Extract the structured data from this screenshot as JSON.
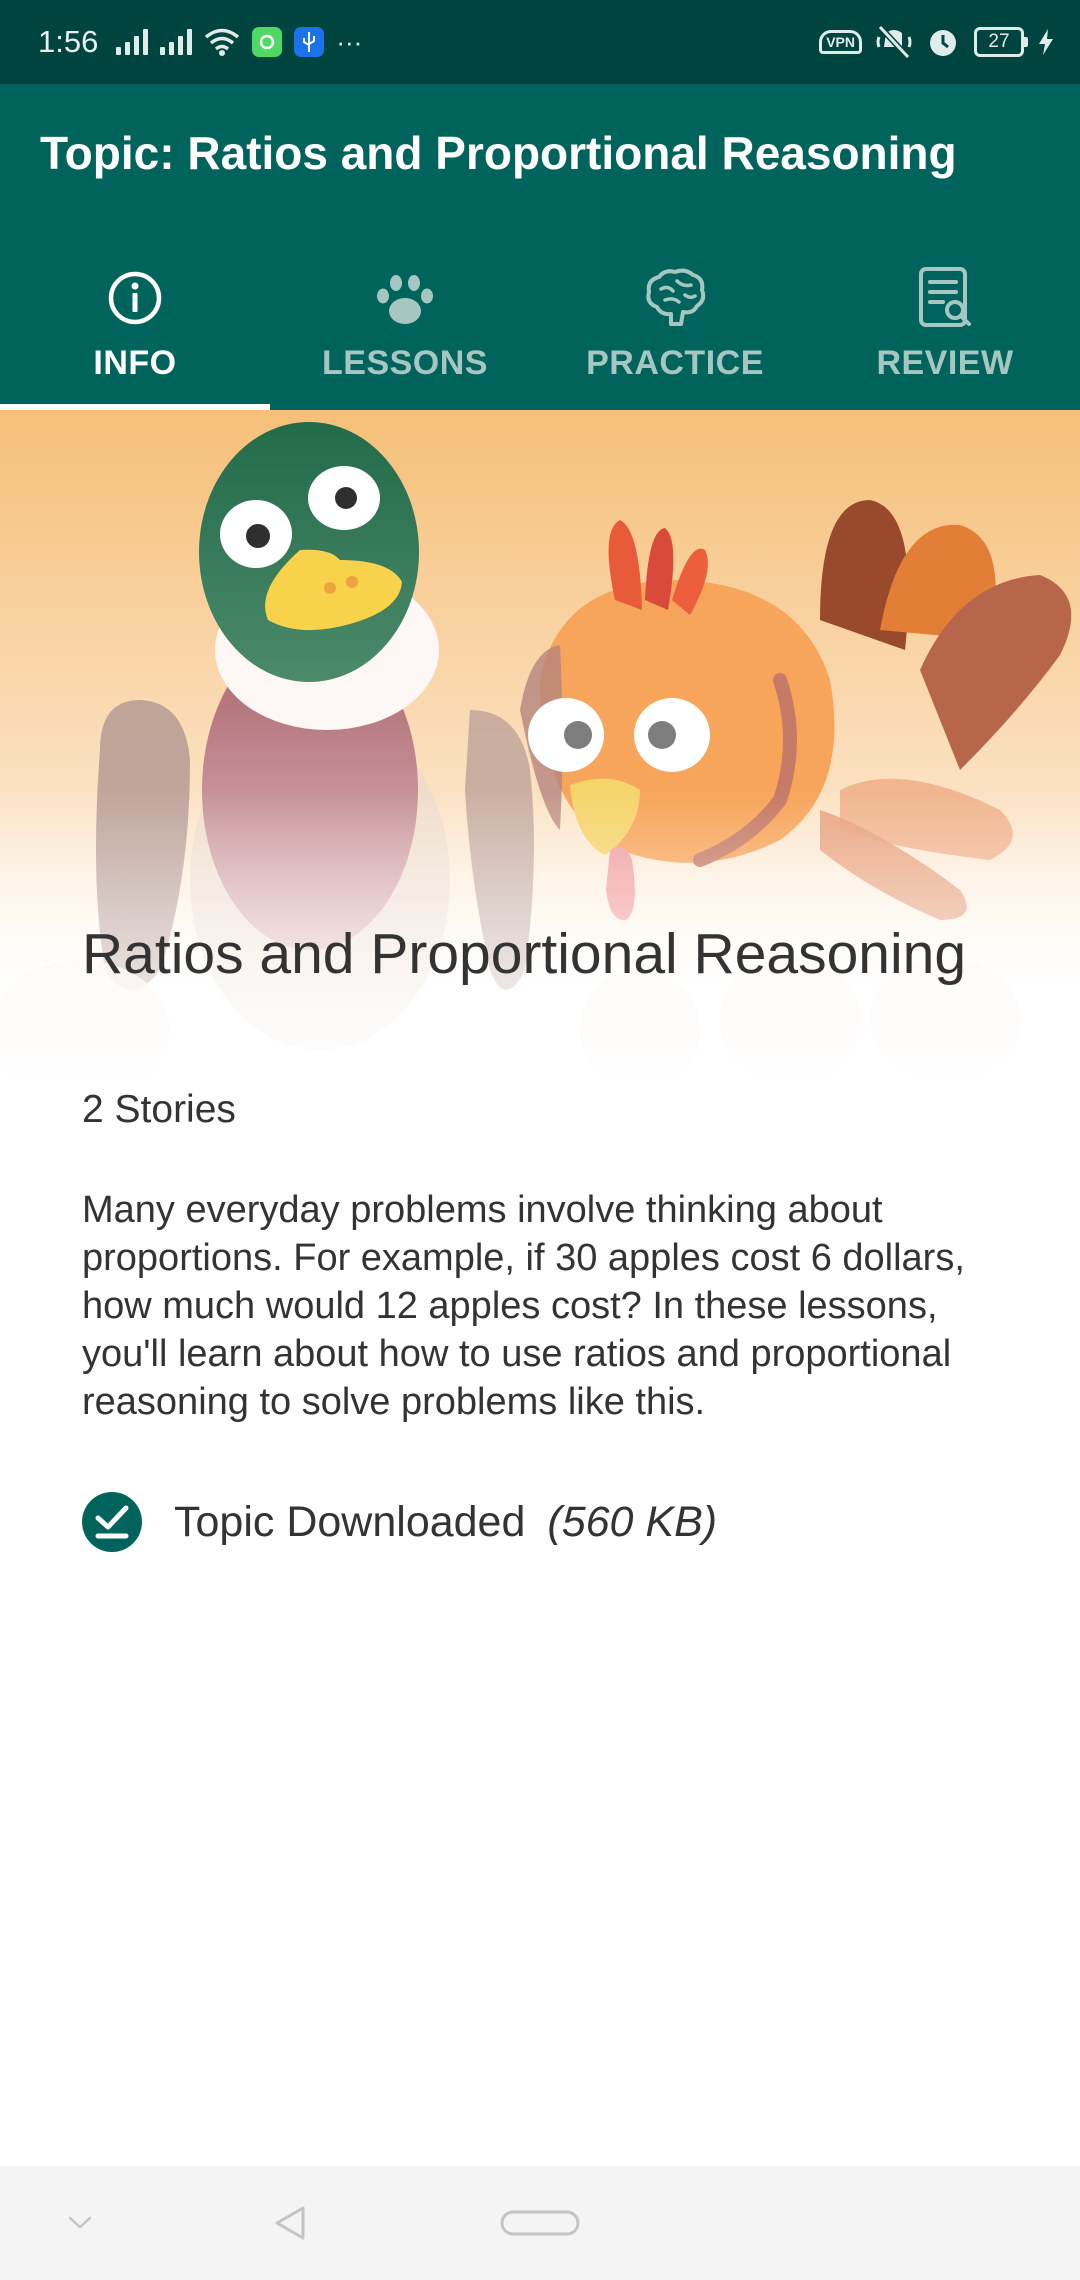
{
  "status_bar": {
    "time": "1:56",
    "more": "···",
    "vpn_label": "VPN",
    "battery_level": "27"
  },
  "app_bar": {
    "title": "Topic: Ratios and Proportional Reasoning"
  },
  "tabs": [
    {
      "label": "INFO",
      "icon": "info-icon",
      "active": true
    },
    {
      "label": "LESSONS",
      "icon": "paw-icon",
      "active": false
    },
    {
      "label": "PRACTICE",
      "icon": "brain-icon",
      "active": false
    },
    {
      "label": "REVIEW",
      "icon": "review-icon",
      "active": false
    }
  ],
  "topic": {
    "name": "Ratios and Proportional Reasoning",
    "story_count": "2 Stories",
    "description": "Many everyday problems involve thinking about proportions. For example, if 30 apples cost 6 dollars, how much would 12 apples cost? In these lessons, you'll learn about how to use ratios and proportional reasoning to solve problems like this.",
    "download_status": "Topic Downloaded",
    "download_size": "(560 KB)"
  },
  "colors": {
    "status_bar": "#00443f",
    "app_bar": "#00645c",
    "tab_inactive": "#a6c6c2",
    "accent": "#00645c"
  }
}
